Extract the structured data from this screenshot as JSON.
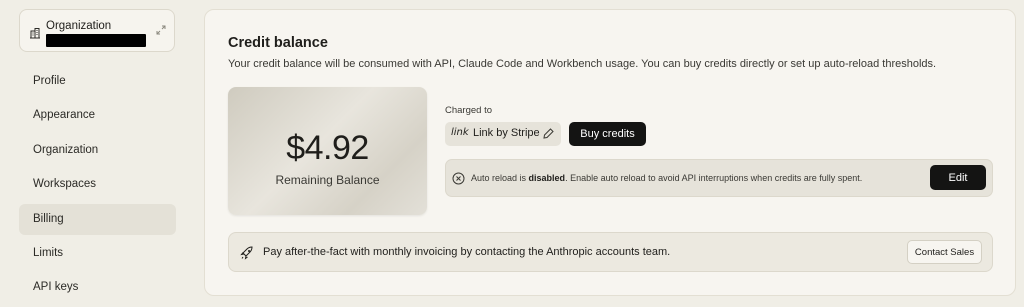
{
  "sidebar": {
    "org_label": "Organization",
    "items": [
      {
        "label": "Profile",
        "active": false
      },
      {
        "label": "Appearance",
        "active": false
      },
      {
        "label": "Organization",
        "active": false
      },
      {
        "label": "Workspaces",
        "active": false
      },
      {
        "label": "Billing",
        "active": true
      },
      {
        "label": "Limits",
        "active": false
      },
      {
        "label": "API keys",
        "active": false
      }
    ]
  },
  "credit": {
    "title": "Credit balance",
    "description": "Your credit balance will be consumed with API, Claude Code and Workbench usage. You can buy credits directly or set up auto-reload thresholds.",
    "amount": "$4.92",
    "amount_label": "Remaining Balance",
    "charged_to_label": "Charged to",
    "payment_logo": "link",
    "payment_method": "Link by Stripe",
    "buy_label": "Buy credits"
  },
  "reload": {
    "prefix": "Auto reload is ",
    "status": "disabled",
    "suffix": ". Enable auto reload to avoid API interruptions when credits are fully spent.",
    "edit_label": "Edit"
  },
  "invoice": {
    "text": "Pay after-the-fact with monthly invoicing by contacting the Anthropic accounts team.",
    "contact_label": "Contact Sales"
  },
  "icons": {
    "org": "building-icon",
    "expand": "expand-icon",
    "pencil": "pencil-icon",
    "reload_status": "x-circle-icon",
    "invoice": "rocket-icon"
  },
  "colors": {
    "background": "#f0eee6",
    "primary_button": "#141413",
    "active_nav": "#e4e1d7"
  }
}
